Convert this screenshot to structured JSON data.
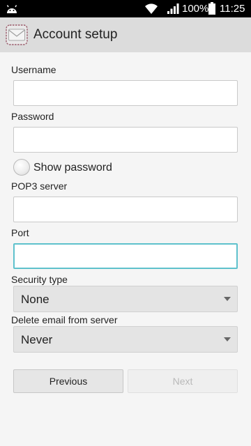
{
  "status_bar": {
    "battery_percent": "100%",
    "time": "11:25",
    "icons": [
      "android-icon",
      "wifi-icon",
      "signal-icon",
      "battery-icon"
    ]
  },
  "action_bar": {
    "title": "Account setup",
    "icon": "email-envelope-icon"
  },
  "form": {
    "username": {
      "label": "Username",
      "value": ""
    },
    "password": {
      "label": "Password",
      "value": ""
    },
    "show_password": {
      "label": "Show password",
      "checked": false
    },
    "pop3_server": {
      "label": "POP3 server",
      "value": ""
    },
    "port": {
      "label": "Port",
      "value": "",
      "focused": true
    },
    "security_type": {
      "label": "Security type",
      "selected": "None"
    },
    "delete_email": {
      "label": "Delete email from server",
      "selected": "Never"
    }
  },
  "buttons": {
    "previous": "Previous",
    "next": "Next"
  },
  "colors": {
    "focus_border": "#5ec1cc",
    "action_bar_bg": "#dcdcdc",
    "status_bar_bg": "#000000",
    "disabled_text": "#b9b9b9"
  }
}
